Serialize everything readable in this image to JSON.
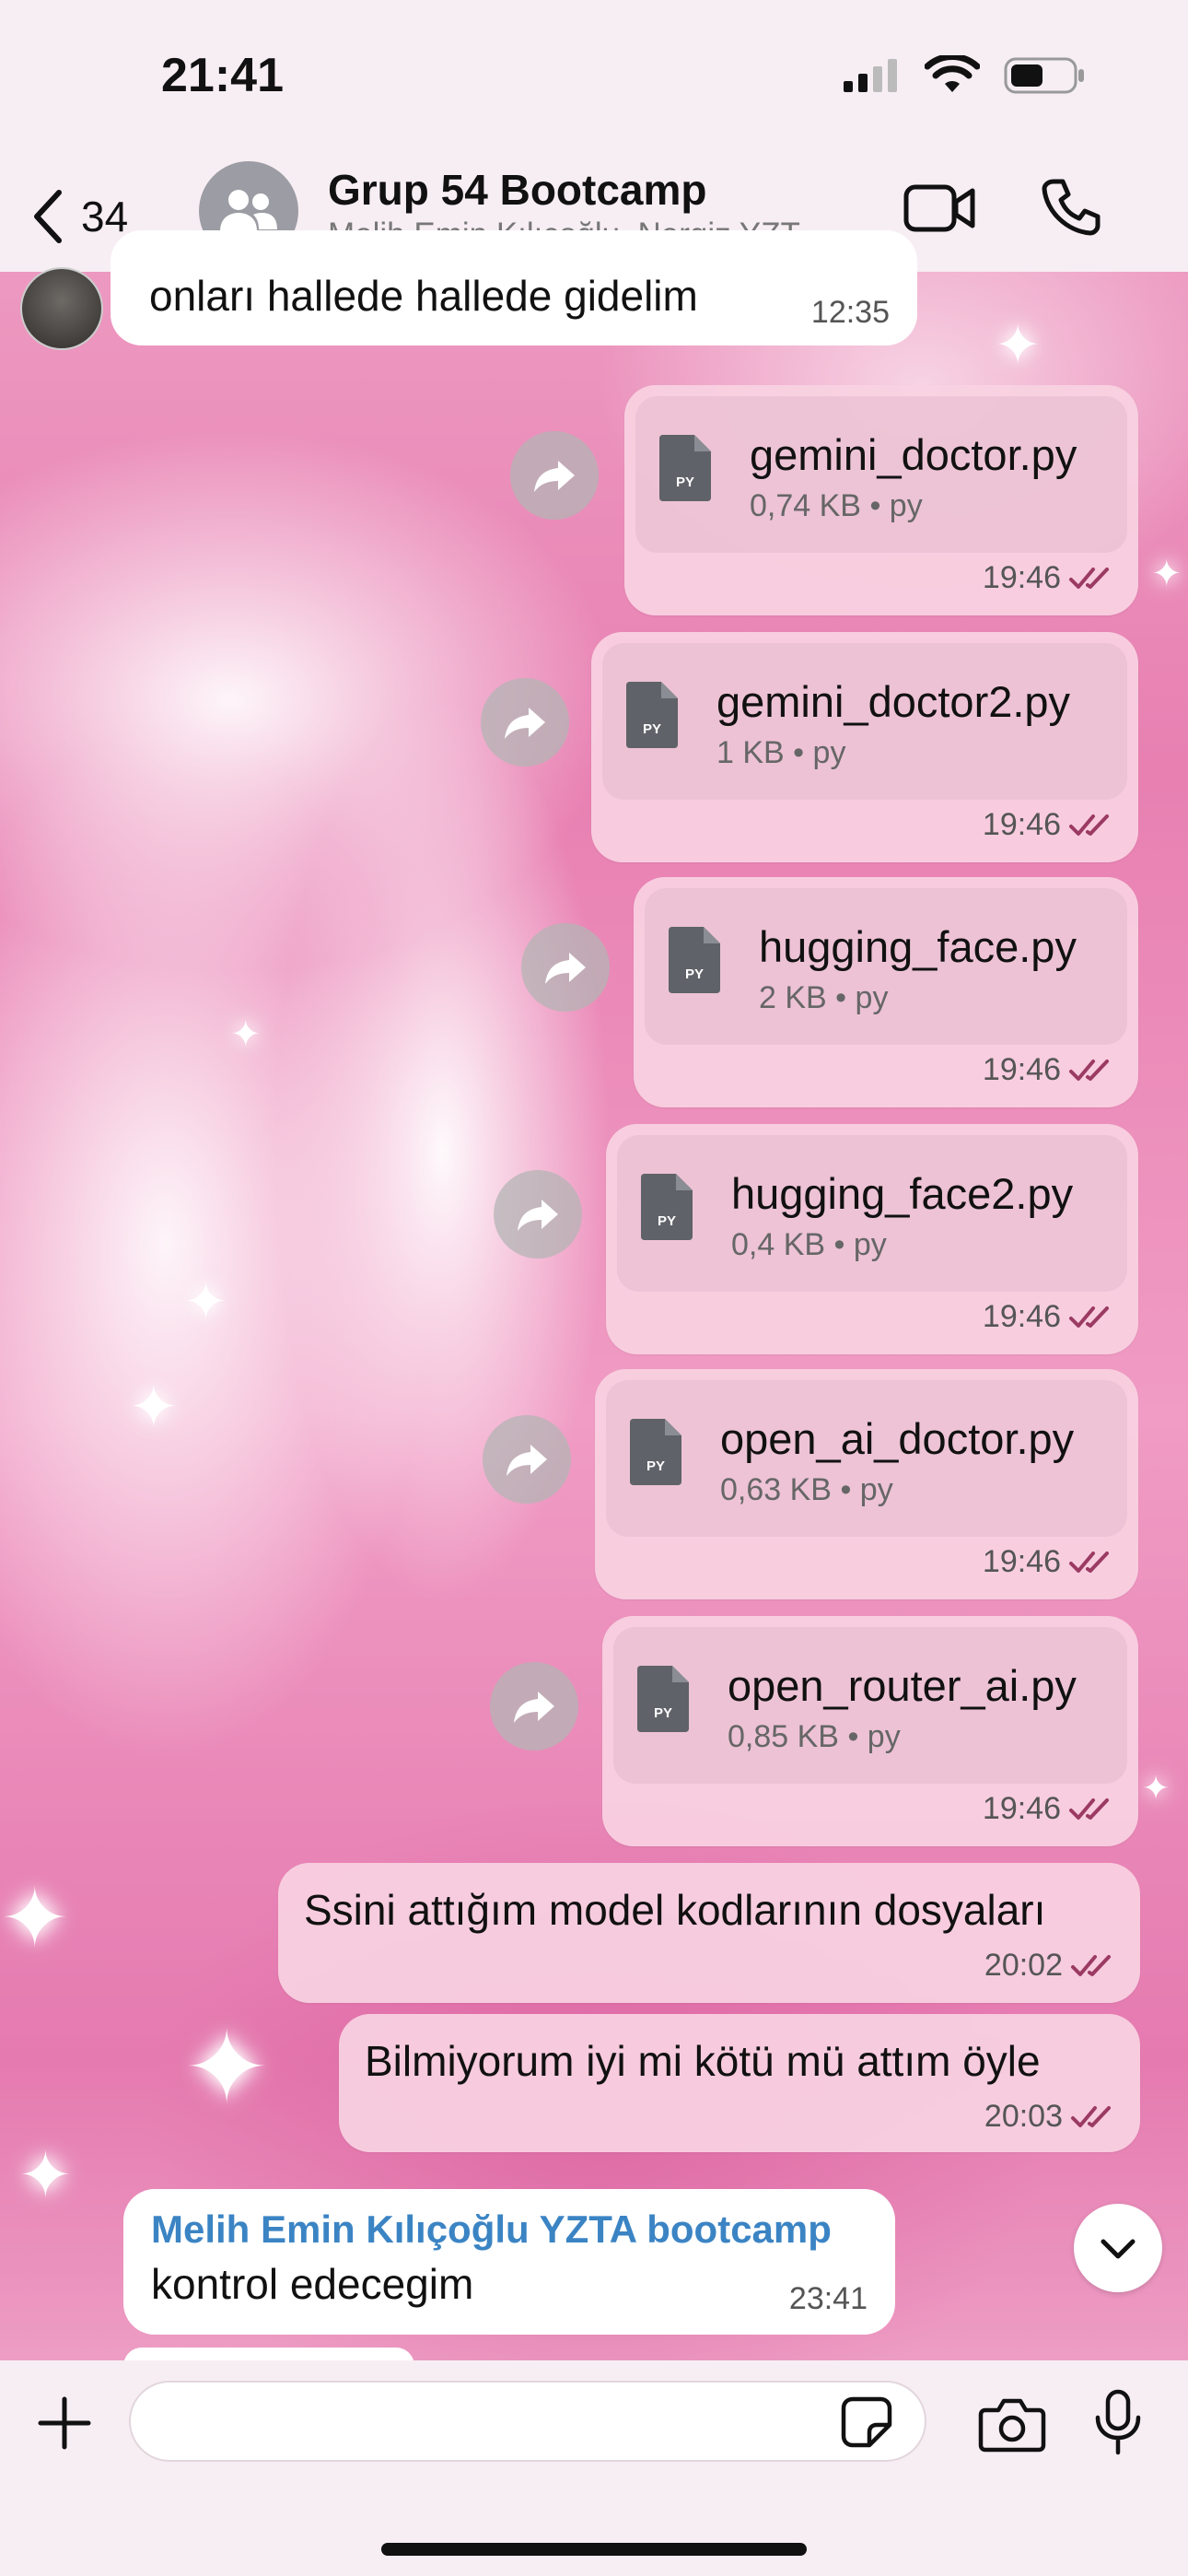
{
  "status_bar": {
    "time": "21:41"
  },
  "header": {
    "back_count": "34",
    "group_name": "Grup 54 Bootcamp",
    "members": "Melih Emin Kılıçoğlu, Nergiz YZT..."
  },
  "messages": {
    "first_incoming": {
      "text": "onları hallede hallede gidelim",
      "time": "12:35"
    },
    "files": [
      {
        "name": "gemini_doctor.py",
        "size": "0,74 KB",
        "ext": "py",
        "time": "19:46"
      },
      {
        "name": "gemini_doctor2.py",
        "size": "1 KB",
        "ext": "py",
        "time": "19:46"
      },
      {
        "name": "hugging_face.py",
        "size": "2 KB",
        "ext": "py",
        "time": "19:46"
      },
      {
        "name": "hugging_face2.py",
        "size": "0,4 KB",
        "ext": "py",
        "time": "19:46"
      },
      {
        "name": "open_ai_doctor.py",
        "size": "0,63 KB",
        "ext": "py",
        "time": "19:46"
      },
      {
        "name": "open_router_ai.py",
        "size": "0,85 KB",
        "ext": "py",
        "time": "19:46"
      }
    ],
    "file_icon_label": "PY",
    "meta_separator": "•",
    "outgoing_text_1": {
      "text": "Ssini attığım model kodlarının dosyaları",
      "time": "20:02"
    },
    "outgoing_text_2": {
      "text": "Bilmiyorum iyi mi kötü mü attım öyle",
      "time": "20:03"
    },
    "last_incoming": {
      "sender": "Melih Emin Kılıçoğlu YZTA bootcamp",
      "text": "kontrol edecegim",
      "time": "23:41"
    }
  },
  "composer": {
    "placeholder": ""
  },
  "colors": {
    "read_ticks": "#9b3a63",
    "sender_name": "#3b84c4",
    "outgoing_bubble": "#f8d2e2"
  },
  "icons": [
    "back-chevron-icon",
    "group-avatar-icon",
    "video-call-icon",
    "phone-call-icon",
    "file-icon",
    "forward-icon",
    "double-check-icon",
    "chevron-down-icon",
    "plus-icon",
    "sticker-icon",
    "camera-icon",
    "microphone-icon"
  ]
}
